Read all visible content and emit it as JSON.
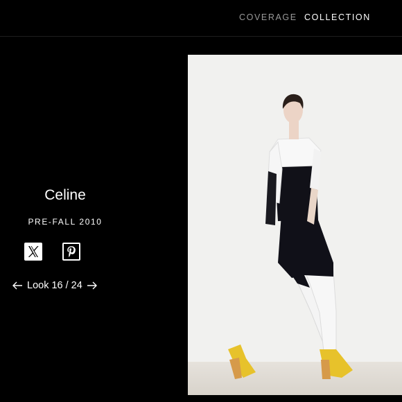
{
  "nav": {
    "items": [
      {
        "label": "COVERAGE",
        "active": false
      },
      {
        "label": "COLLECTION",
        "active": true
      }
    ]
  },
  "show": {
    "designer": "Celine",
    "season": "PRE-FALL 2010"
  },
  "social": {
    "x_icon": "x-logo-icon",
    "pinterest_icon": "pinterest-icon"
  },
  "look": {
    "label": "Look 16 / 24"
  },
  "colors": {
    "background": "#000000",
    "text": "#ffffff",
    "nav_inactive": "#9a9a9a",
    "photo_background": "#f1f1ef",
    "shoes": "#e7c22b"
  }
}
